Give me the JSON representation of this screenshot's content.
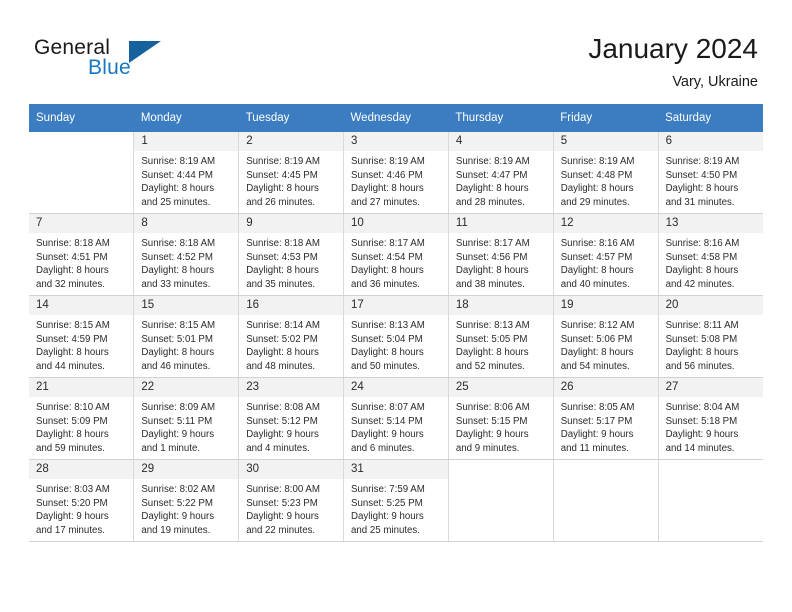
{
  "brand": {
    "word1": "General",
    "word2": "Blue",
    "triangle_color": "#17619e",
    "blue_color": "#1878be",
    "logo_icon": "triangle-flag-icon"
  },
  "header": {
    "title": "January 2024",
    "location": "Vary, Ukraine"
  },
  "calendar": {
    "header_background": "#3b7dc0",
    "daynum_background": "#f2f2f2",
    "weekdays": [
      "Sunday",
      "Monday",
      "Tuesday",
      "Wednesday",
      "Thursday",
      "Friday",
      "Saturday"
    ],
    "weeks": [
      [
        {
          "day": "",
          "lines": []
        },
        {
          "day": "1",
          "lines": [
            "Sunrise: 8:19 AM",
            "Sunset: 4:44 PM",
            "Daylight: 8 hours",
            "and 25 minutes."
          ]
        },
        {
          "day": "2",
          "lines": [
            "Sunrise: 8:19 AM",
            "Sunset: 4:45 PM",
            "Daylight: 8 hours",
            "and 26 minutes."
          ]
        },
        {
          "day": "3",
          "lines": [
            "Sunrise: 8:19 AM",
            "Sunset: 4:46 PM",
            "Daylight: 8 hours",
            "and 27 minutes."
          ]
        },
        {
          "day": "4",
          "lines": [
            "Sunrise: 8:19 AM",
            "Sunset: 4:47 PM",
            "Daylight: 8 hours",
            "and 28 minutes."
          ]
        },
        {
          "day": "5",
          "lines": [
            "Sunrise: 8:19 AM",
            "Sunset: 4:48 PM",
            "Daylight: 8 hours",
            "and 29 minutes."
          ]
        },
        {
          "day": "6",
          "lines": [
            "Sunrise: 8:19 AM",
            "Sunset: 4:50 PM",
            "Daylight: 8 hours",
            "and 31 minutes."
          ]
        }
      ],
      [
        {
          "day": "7",
          "lines": [
            "Sunrise: 8:18 AM",
            "Sunset: 4:51 PM",
            "Daylight: 8 hours",
            "and 32 minutes."
          ]
        },
        {
          "day": "8",
          "lines": [
            "Sunrise: 8:18 AM",
            "Sunset: 4:52 PM",
            "Daylight: 8 hours",
            "and 33 minutes."
          ]
        },
        {
          "day": "9",
          "lines": [
            "Sunrise: 8:18 AM",
            "Sunset: 4:53 PM",
            "Daylight: 8 hours",
            "and 35 minutes."
          ]
        },
        {
          "day": "10",
          "lines": [
            "Sunrise: 8:17 AM",
            "Sunset: 4:54 PM",
            "Daylight: 8 hours",
            "and 36 minutes."
          ]
        },
        {
          "day": "11",
          "lines": [
            "Sunrise: 8:17 AM",
            "Sunset: 4:56 PM",
            "Daylight: 8 hours",
            "and 38 minutes."
          ]
        },
        {
          "day": "12",
          "lines": [
            "Sunrise: 8:16 AM",
            "Sunset: 4:57 PM",
            "Daylight: 8 hours",
            "and 40 minutes."
          ]
        },
        {
          "day": "13",
          "lines": [
            "Sunrise: 8:16 AM",
            "Sunset: 4:58 PM",
            "Daylight: 8 hours",
            "and 42 minutes."
          ]
        }
      ],
      [
        {
          "day": "14",
          "lines": [
            "Sunrise: 8:15 AM",
            "Sunset: 4:59 PM",
            "Daylight: 8 hours",
            "and 44 minutes."
          ]
        },
        {
          "day": "15",
          "lines": [
            "Sunrise: 8:15 AM",
            "Sunset: 5:01 PM",
            "Daylight: 8 hours",
            "and 46 minutes."
          ]
        },
        {
          "day": "16",
          "lines": [
            "Sunrise: 8:14 AM",
            "Sunset: 5:02 PM",
            "Daylight: 8 hours",
            "and 48 minutes."
          ]
        },
        {
          "day": "17",
          "lines": [
            "Sunrise: 8:13 AM",
            "Sunset: 5:04 PM",
            "Daylight: 8 hours",
            "and 50 minutes."
          ]
        },
        {
          "day": "18",
          "lines": [
            "Sunrise: 8:13 AM",
            "Sunset: 5:05 PM",
            "Daylight: 8 hours",
            "and 52 minutes."
          ]
        },
        {
          "day": "19",
          "lines": [
            "Sunrise: 8:12 AM",
            "Sunset: 5:06 PM",
            "Daylight: 8 hours",
            "and 54 minutes."
          ]
        },
        {
          "day": "20",
          "lines": [
            "Sunrise: 8:11 AM",
            "Sunset: 5:08 PM",
            "Daylight: 8 hours",
            "and 56 minutes."
          ]
        }
      ],
      [
        {
          "day": "21",
          "lines": [
            "Sunrise: 8:10 AM",
            "Sunset: 5:09 PM",
            "Daylight: 8 hours",
            "and 59 minutes."
          ]
        },
        {
          "day": "22",
          "lines": [
            "Sunrise: 8:09 AM",
            "Sunset: 5:11 PM",
            "Daylight: 9 hours",
            "and 1 minute."
          ]
        },
        {
          "day": "23",
          "lines": [
            "Sunrise: 8:08 AM",
            "Sunset: 5:12 PM",
            "Daylight: 9 hours",
            "and 4 minutes."
          ]
        },
        {
          "day": "24",
          "lines": [
            "Sunrise: 8:07 AM",
            "Sunset: 5:14 PM",
            "Daylight: 9 hours",
            "and 6 minutes."
          ]
        },
        {
          "day": "25",
          "lines": [
            "Sunrise: 8:06 AM",
            "Sunset: 5:15 PM",
            "Daylight: 9 hours",
            "and 9 minutes."
          ]
        },
        {
          "day": "26",
          "lines": [
            "Sunrise: 8:05 AM",
            "Sunset: 5:17 PM",
            "Daylight: 9 hours",
            "and 11 minutes."
          ]
        },
        {
          "day": "27",
          "lines": [
            "Sunrise: 8:04 AM",
            "Sunset: 5:18 PM",
            "Daylight: 9 hours",
            "and 14 minutes."
          ]
        }
      ],
      [
        {
          "day": "28",
          "lines": [
            "Sunrise: 8:03 AM",
            "Sunset: 5:20 PM",
            "Daylight: 9 hours",
            "and 17 minutes."
          ]
        },
        {
          "day": "29",
          "lines": [
            "Sunrise: 8:02 AM",
            "Sunset: 5:22 PM",
            "Daylight: 9 hours",
            "and 19 minutes."
          ]
        },
        {
          "day": "30",
          "lines": [
            "Sunrise: 8:00 AM",
            "Sunset: 5:23 PM",
            "Daylight: 9 hours",
            "and 22 minutes."
          ]
        },
        {
          "day": "31",
          "lines": [
            "Sunrise: 7:59 AM",
            "Sunset: 5:25 PM",
            "Daylight: 9 hours",
            "and 25 minutes."
          ]
        },
        {
          "day": "",
          "lines": []
        },
        {
          "day": "",
          "lines": []
        },
        {
          "day": "",
          "lines": []
        }
      ]
    ]
  }
}
